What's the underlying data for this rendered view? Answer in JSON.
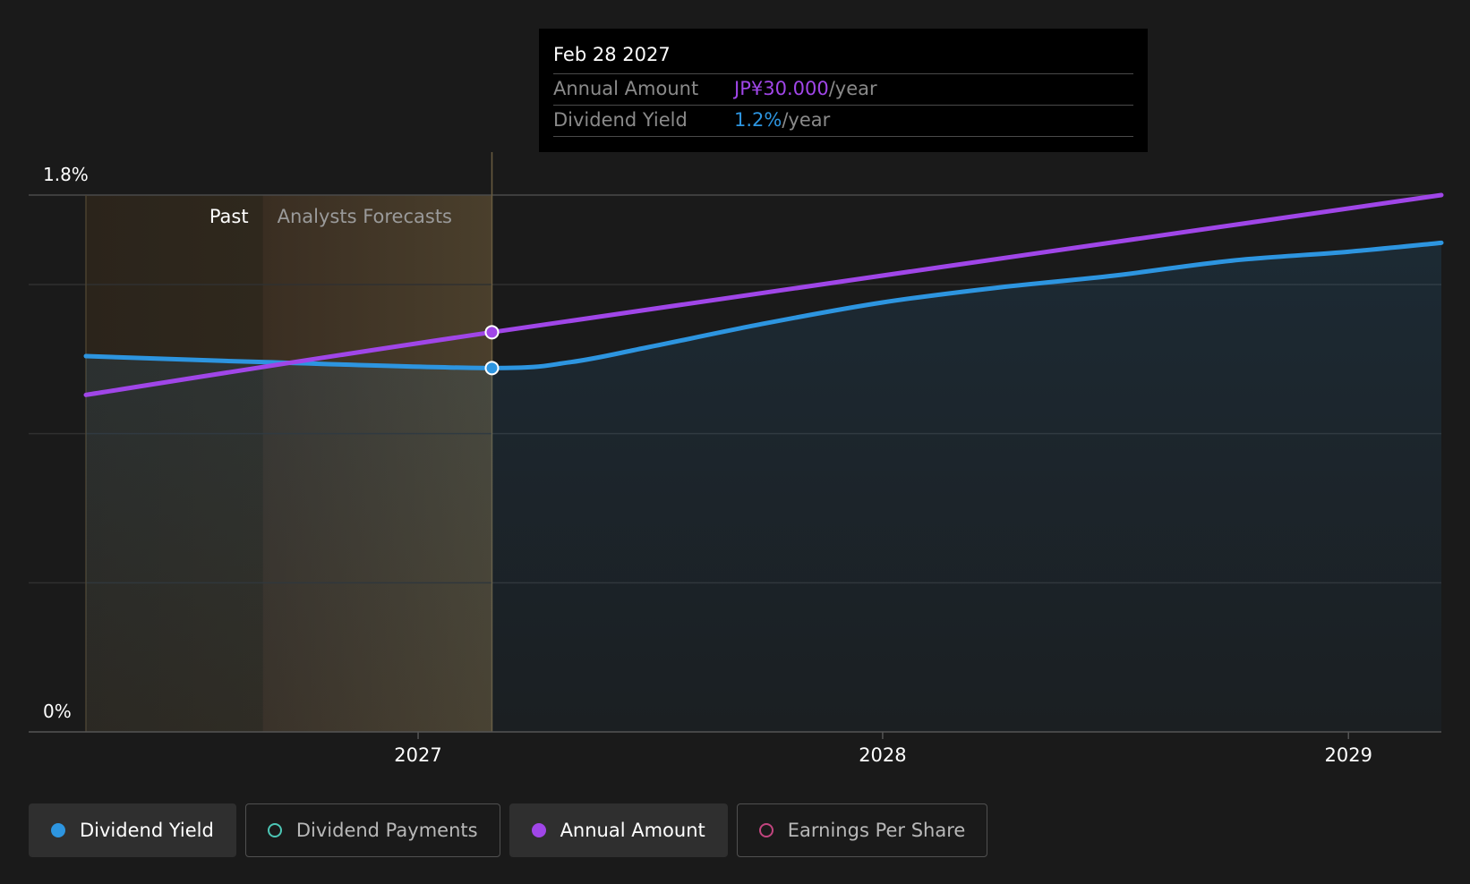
{
  "tooltip": {
    "date": "Feb 28 2027",
    "rows": [
      {
        "label": "Annual Amount",
        "value": "JP¥30.000",
        "unit": "/year",
        "color": "#a046e8"
      },
      {
        "label": "Dividend Yield",
        "value": "1.2%",
        "unit": "/year",
        "color": "#2d95e0"
      }
    ]
  },
  "regions": {
    "past_label": "Past",
    "forecast_label": "Analysts Forecasts"
  },
  "legend": [
    {
      "label": "Dividend Yield",
      "color": "#2d95e0",
      "active": true,
      "filled": true
    },
    {
      "label": "Dividend Payments",
      "color": "#4cc6b5",
      "active": false,
      "filled": false
    },
    {
      "label": "Annual Amount",
      "color": "#a046e8",
      "active": true,
      "filled": true
    },
    {
      "label": "Earnings Per Share",
      "color": "#c2457f",
      "active": false,
      "filled": false
    }
  ],
  "chart_data": {
    "type": "line",
    "y_axis": {
      "min": 0,
      "max": 1.8,
      "tick_labels": [
        "0%",
        "1.8%"
      ]
    },
    "x_axis": {
      "min": "2026-04-15",
      "max": "2029-03-15",
      "tick_labels": [
        "2027",
        "2028",
        "2029"
      ]
    },
    "grid": true,
    "past_start": "2026-04-15",
    "past_end": "2026-09-01",
    "hover_date": "2027-02-28",
    "series": [
      {
        "name": "Dividend Yield",
        "color": "#2d95e0",
        "area": true,
        "points": [
          [
            "2026-04-15",
            1.26
          ],
          [
            "2026-09-01",
            1.24
          ],
          [
            "2027-02-28",
            1.22
          ],
          [
            "2027-05-01",
            1.24
          ],
          [
            "2027-07-01",
            1.29
          ],
          [
            "2027-10-01",
            1.37
          ],
          [
            "2028-01-01",
            1.44
          ],
          [
            "2028-04-01",
            1.49
          ],
          [
            "2028-07-01",
            1.53
          ],
          [
            "2028-10-01",
            1.58
          ],
          [
            "2029-01-01",
            1.61
          ],
          [
            "2029-03-15",
            1.64
          ]
        ]
      },
      {
        "name": "Annual Amount",
        "color": "#a046e8",
        "area": false,
        "points": [
          [
            "2026-04-15",
            1.13
          ],
          [
            "2027-02-28",
            1.34
          ],
          [
            "2029-03-15",
            1.8
          ]
        ]
      }
    ]
  }
}
